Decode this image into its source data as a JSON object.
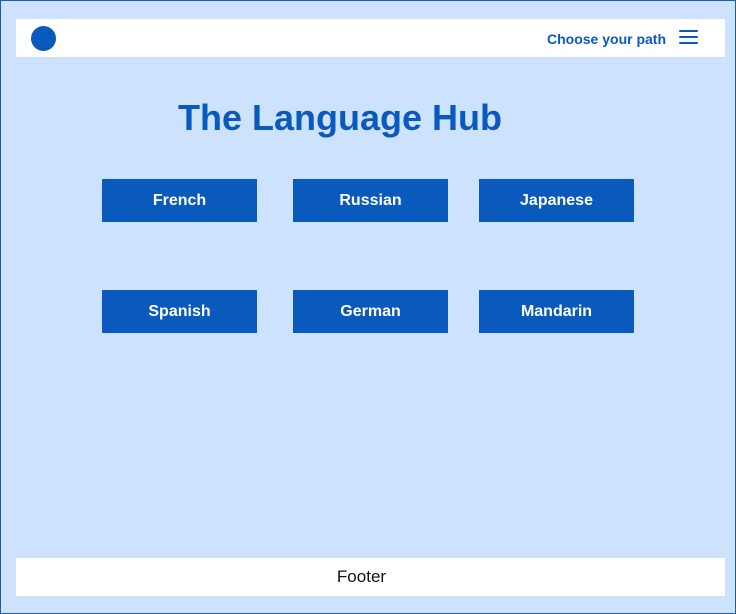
{
  "header": {
    "nav_label": "Choose your path",
    "logo_icon": "circle-logo-icon",
    "menu_icon": "hamburger-menu-icon"
  },
  "main": {
    "title": "The Language Hub",
    "languages": [
      {
        "label": "French"
      },
      {
        "label": "Russian"
      },
      {
        "label": "Japanese"
      },
      {
        "label": "Spanish"
      },
      {
        "label": "German"
      },
      {
        "label": "Mandarin"
      }
    ]
  },
  "footer": {
    "label": "Footer"
  },
  "colors": {
    "background": "#cce2fd",
    "accent": "#0a59bd",
    "surface": "#ffffff",
    "border": "#1f5cae"
  }
}
